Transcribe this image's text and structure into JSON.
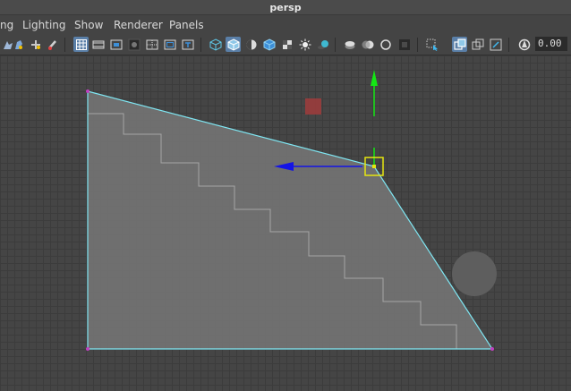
{
  "window": {
    "title": "persp"
  },
  "menu": {
    "items": [
      {
        "label": "ng"
      },
      {
        "label": "Lighting"
      },
      {
        "label": "Show"
      },
      {
        "label": "Renderer"
      },
      {
        "label": "Panels"
      }
    ]
  },
  "toolbar": {
    "icons": [
      "select-camera-icon",
      "lock-camera-icon",
      "camera-attributes-icon",
      "bookmark-icon",
      "grid-icon",
      "film-gate-icon",
      "resolution-gate-icon",
      "gate-mask-icon",
      "field-chart-icon",
      "safe-action-icon",
      "safe-title-icon",
      "wireframe-icon",
      "smooth-shade-icon",
      "flat-shade-icon",
      "wireframe-on-shaded-icon",
      "textured-icon",
      "use-all-lights-icon",
      "shadows-icon",
      "screen-space-ao-icon",
      "motion-blur-icon",
      "multisample-aa-icon",
      "depth-of-field-icon",
      "isolate-select-icon",
      "xray-icon",
      "xray-joints-icon",
      "xray-active-icon",
      "exposure-icon"
    ],
    "exposure_value": "0.00"
  },
  "viewport": {
    "camera": "persp",
    "selection_color": "#e5e510",
    "wireframe_color": "#7fe6f2",
    "manipulator": {
      "x_axis_color": "#1414e6",
      "y_axis_color": "#14e614",
      "center_color": "#e5e510"
    }
  }
}
